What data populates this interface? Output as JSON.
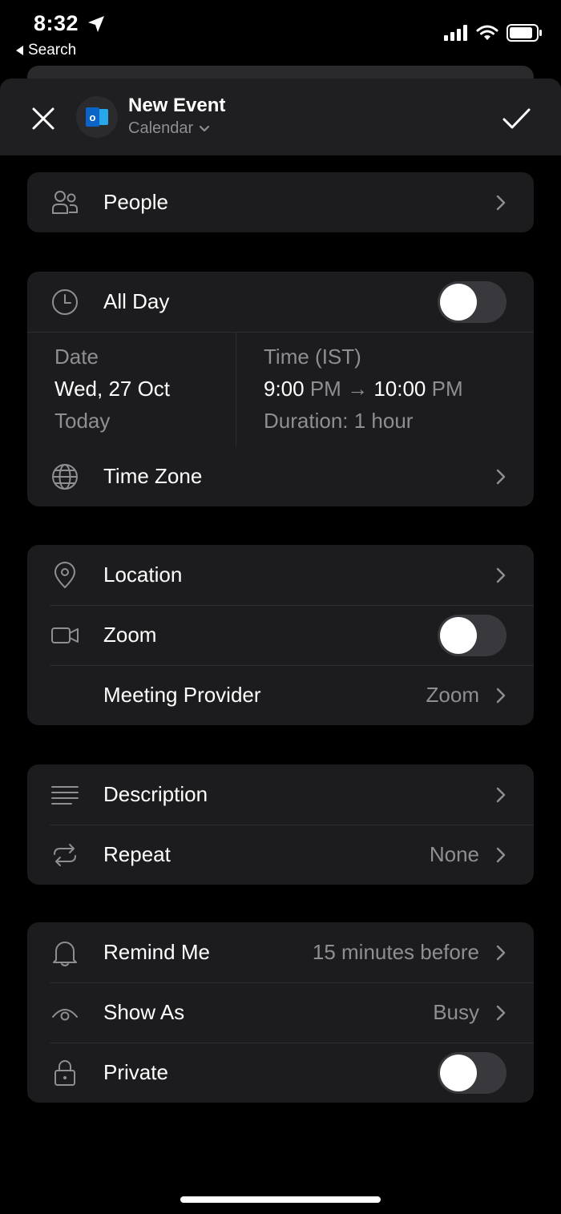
{
  "status_bar": {
    "time": "8:32",
    "back_label": "Search"
  },
  "header": {
    "title": "New Event",
    "subtitle": "Calendar",
    "app_icon_letter": "o"
  },
  "people": {
    "label": "People"
  },
  "all_day": {
    "label": "All Day",
    "enabled": false
  },
  "date": {
    "heading": "Date",
    "value": "Wed, 27 Oct",
    "relative": "Today"
  },
  "time": {
    "heading": "Time (IST)",
    "start_hour": "9:00",
    "start_period": "PM",
    "arrow": "→",
    "end_hour": "10:00",
    "end_period": "PM",
    "duration": "Duration: 1 hour"
  },
  "time_zone": {
    "label": "Time Zone"
  },
  "location": {
    "label": "Location"
  },
  "zoom": {
    "label": "Zoom",
    "enabled": false
  },
  "meeting_provider": {
    "label": "Meeting Provider",
    "value": "Zoom"
  },
  "description": {
    "label": "Description"
  },
  "repeat": {
    "label": "Repeat",
    "value": "None"
  },
  "remind_me": {
    "label": "Remind Me",
    "value": "15 minutes before"
  },
  "show_as": {
    "label": "Show As",
    "value": "Busy"
  },
  "private": {
    "label": "Private",
    "enabled": false
  },
  "colors": {
    "background": "#000000",
    "card": "#1c1c1e",
    "secondary_text": "#8e8e93",
    "outlook_blue": "#0a64c8"
  }
}
